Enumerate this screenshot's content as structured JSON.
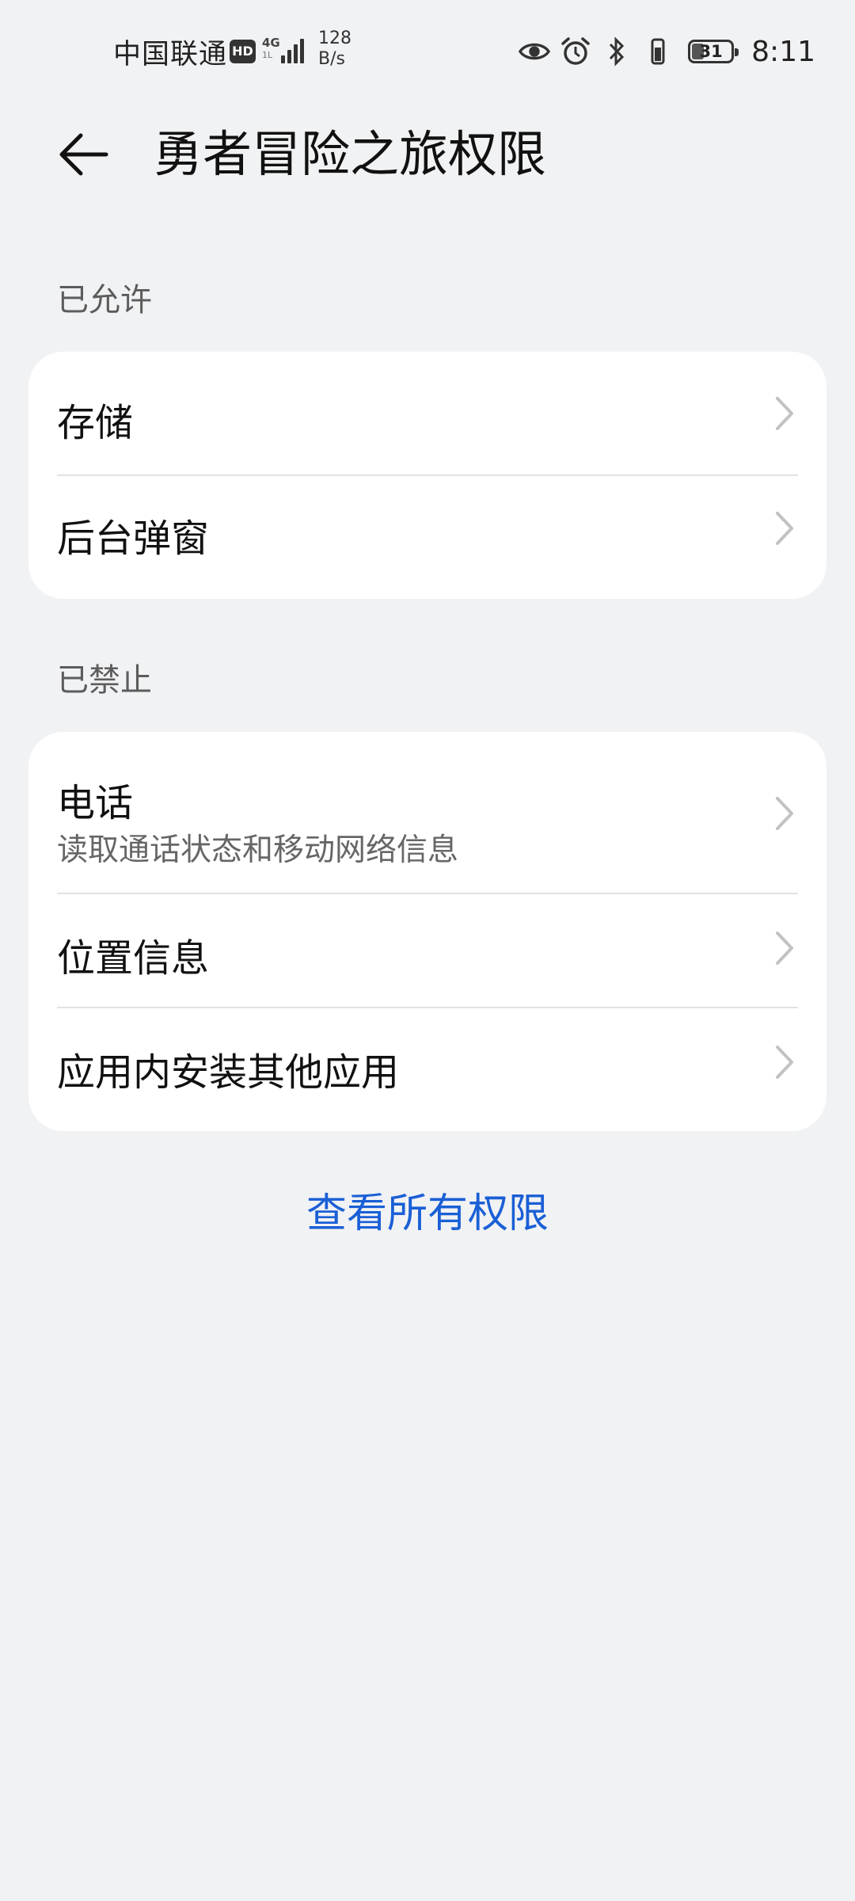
{
  "status_bar": {
    "carrier": "中国联通",
    "hd": "HD",
    "net": "4G",
    "net_sub": "1L",
    "speed_value": "128",
    "speed_unit": "B/s",
    "battery": "31",
    "battery_level": 0.31,
    "time": "8:11",
    "icons": [
      "eye-comfort-icon",
      "alarm-icon",
      "bluetooth-icon",
      "vibrate-icon",
      "battery-icon"
    ]
  },
  "header": {
    "title": "勇者冒险之旅权限"
  },
  "allowed": {
    "label": "已允许",
    "items": [
      {
        "title": "存储"
      },
      {
        "title": "后台弹窗"
      }
    ]
  },
  "denied": {
    "label": "已禁止",
    "items": [
      {
        "title": "电话",
        "subtitle": "读取通话状态和移动网络信息"
      },
      {
        "title": "位置信息"
      },
      {
        "title": "应用内安装其他应用"
      }
    ]
  },
  "footer": {
    "view_all_label": "查看所有权限"
  },
  "colors": {
    "background": "#f1f2f4",
    "card": "#ffffff",
    "link": "#1a5fd6",
    "secondary_text": "#666666"
  }
}
